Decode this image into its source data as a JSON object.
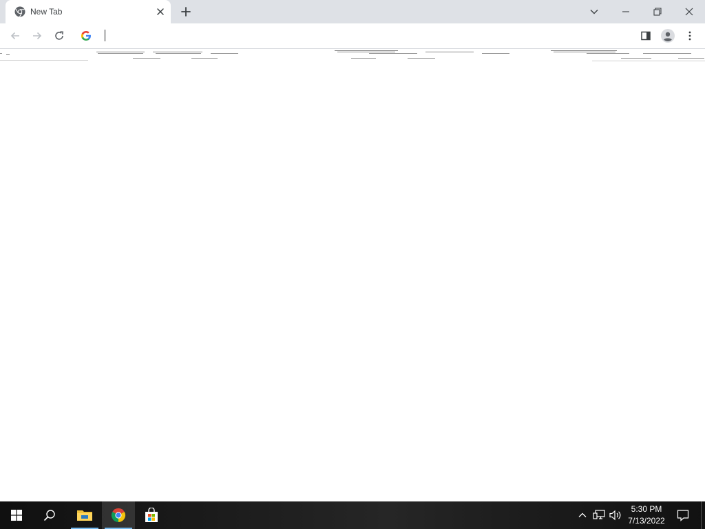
{
  "browser": {
    "tab": {
      "title": "New Tab",
      "icon": "chrome-icon"
    },
    "new_tab_icon": "plus-icon",
    "window_controls": [
      "tab-search-icon",
      "minimize-icon",
      "restore-icon",
      "close-icon"
    ],
    "toolbar": {
      "back_icon": "arrow-left-icon",
      "forward_icon": "arrow-right-icon",
      "reload_icon": "reload-icon",
      "search_engine_icon": "google-icon",
      "address_value": "",
      "side_panel_icon": "side-panel-icon",
      "profile_icon": "profile-icon",
      "menu_icon": "kebab-menu-icon"
    }
  },
  "taskbar": {
    "items": [
      "windows-start-icon",
      "search-icon",
      "file-explorer-icon",
      "chrome-icon",
      "microsoft-store-icon"
    ],
    "active_item": "chrome-icon",
    "tray": [
      "chevron-up-icon",
      "network-icon",
      "volume-icon",
      "notification-icon"
    ],
    "clock": {
      "time": "5:30 PM",
      "date": "7/13/2022"
    }
  },
  "colors": {
    "tab_strip": "#dee1e6",
    "taskbar": "#1b1b1b",
    "accent": "#76b9ed"
  }
}
